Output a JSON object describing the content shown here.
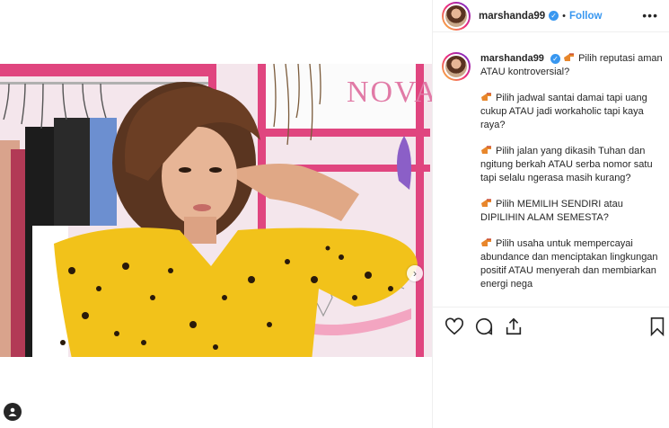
{
  "post": {
    "username": "marshanda99",
    "verified_mark": "✓",
    "separator": "•",
    "follow_label": "Follow",
    "more_icon": "•••"
  },
  "caption": {
    "username": "marshanda99",
    "lines": [
      "Pilih reputasi aman ATAU kontroversial?",
      "Pilih jadwal santai damai tapi uang cukup ATAU jadi workaholic tapi kaya raya?",
      "Pilih jalan yang dikasih Tuhan dan ngitung berkah ATAU serba nomor satu tapi selalu ngerasa masih kurang?",
      "Pilih MEMILIH SENDIRI atau DIPILIHIN ALAM SEMESTA?",
      "Pilih usaha untuk mempercayai abundance dan menciptakan lingkungan positif ATAU menyerah dan membiarkan energi nega"
    ]
  },
  "photo": {
    "sign_text": "NOVA",
    "carousel_next_glyph": "›"
  },
  "icons": {
    "like": "heart-icon",
    "comment": "comment-icon",
    "share": "share-icon",
    "save": "bookmark-icon",
    "tag": "user-tag-icon",
    "emoji": "pointing-hand-emoji"
  },
  "colors": {
    "accent": "#3897f0",
    "text": "#262626",
    "border": "#efefef",
    "dress": "#f2c21a"
  }
}
